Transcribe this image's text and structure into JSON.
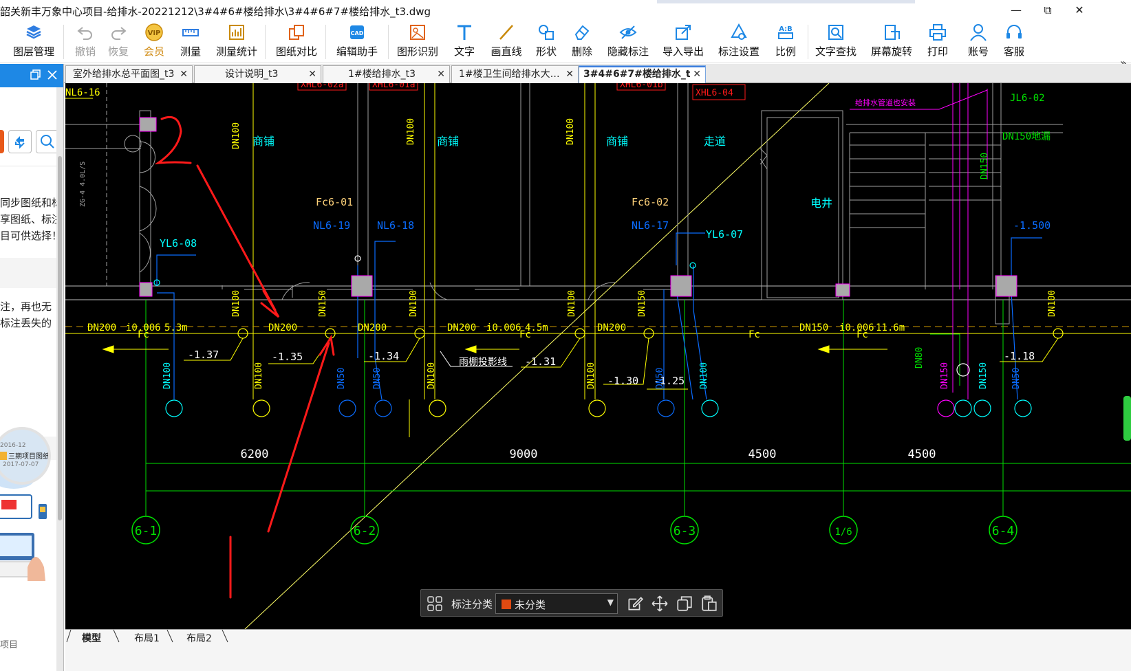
{
  "window": {
    "title": "韶关新丰万象中心项目-给排水-20221212\\3#4#6#楼给排水\\3#4#6#7#楼给排水_t3.dwg",
    "minimize": "—",
    "maximize": "⧉",
    "close": "✕"
  },
  "toolbar": [
    {
      "label": "图层管理",
      "icon": "layers-icon",
      "state": "normal"
    },
    {
      "label": "撤销",
      "icon": "undo-icon",
      "state": "disabled"
    },
    {
      "label": "恢复",
      "icon": "redo-icon",
      "state": "disabled"
    },
    {
      "label": "会员",
      "icon": "vip-icon",
      "state": "vip"
    },
    {
      "label": "测量",
      "icon": "measure-icon",
      "state": "normal"
    },
    {
      "label": "测量统计",
      "icon": "measure-stats-icon",
      "state": "normal"
    },
    {
      "label": "图纸对比",
      "icon": "compare-icon",
      "state": "normal"
    },
    {
      "label": "编辑助手",
      "icon": "edit-assistant-icon",
      "state": "normal"
    },
    {
      "label": "图形识别",
      "icon": "shape-recognize-icon",
      "state": "normal"
    },
    {
      "label": "文字",
      "icon": "text-icon",
      "state": "normal"
    },
    {
      "label": "画直线",
      "icon": "line-icon",
      "state": "normal"
    },
    {
      "label": "形状",
      "icon": "shapes-icon",
      "state": "normal"
    },
    {
      "label": "删除",
      "icon": "eraser-icon",
      "state": "normal"
    },
    {
      "label": "隐藏标注",
      "icon": "hide-eye-icon",
      "state": "normal"
    },
    {
      "label": "导入导出",
      "icon": "import-export-icon",
      "state": "normal"
    },
    {
      "label": "标注设置",
      "icon": "markup-settings-icon",
      "state": "normal"
    },
    {
      "label": "比例",
      "icon": "scale-icon",
      "state": "normal"
    },
    {
      "label": "文字查找",
      "icon": "text-search-icon",
      "state": "normal"
    },
    {
      "label": "屏幕旋转",
      "icon": "rotate-screen-icon",
      "state": "normal"
    },
    {
      "label": "打印",
      "icon": "printer-icon",
      "state": "normal"
    },
    {
      "label": "账号",
      "icon": "user-icon",
      "state": "normal"
    },
    {
      "label": "客服",
      "icon": "headset-icon",
      "state": "normal"
    }
  ],
  "sidebar": {
    "lines": [
      "同步图纸和标",
      "享图纸、标注",
      "目可供选择！",
      "注，再也无",
      "标注丢失的"
    ],
    "card_date1": "2016-12",
    "card_label": "三期项目图纸",
    "card_date2": "2017-07-07",
    "bottom": "项目"
  },
  "tabs": [
    {
      "label": "室外给排水总平面图_t3",
      "active": false
    },
    {
      "label": "设计说明_t3",
      "active": false
    },
    {
      "label": "1#楼给排水_t3",
      "active": false
    },
    {
      "label": "1#楼卫生间给排水大…",
      "active": false
    },
    {
      "label": "3#4#6#7#楼给排水_t3",
      "active": true
    }
  ],
  "tab_close": "✕",
  "drawing": {
    "spaces": [
      "商铺",
      "商铺",
      "商铺",
      "走道",
      "电井"
    ],
    "tags": [
      "XHL6-02a",
      "XHL6-01a",
      "XHL6-01b",
      "XHL6-04",
      "JL6-02",
      "DN150地漏",
      "给排水管道也安装",
      "Fc6-01",
      "NL6-19",
      "NL6-18",
      "Fc6-02",
      "NL6-17",
      "YL6-07",
      "NL6-16",
      "YL6-08",
      "-1.500"
    ],
    "pipe_labels": [
      "DN200",
      "i0.006",
      "5.3m",
      "DN200",
      "DN200",
      "DN200",
      "i0.006",
      "4.5m",
      "DN200",
      "DN150",
      "i0.006",
      "11.6m",
      "Fc",
      "Fc",
      "Fc",
      "Fc"
    ],
    "levels": [
      "-1.37",
      "-1.35",
      "-1.34",
      "-1.31",
      "-1.30",
      "-1.25",
      "-1.18"
    ],
    "canopy_note": "雨棚投影线",
    "dims": [
      "6200",
      "9000",
      "4500",
      "4500"
    ],
    "axes": [
      "6-1",
      "6-2",
      "6-3",
      "1/6",
      "6-4"
    ],
    "annotation_2": "2",
    "annotation_1": "1"
  },
  "markup_panel": {
    "label": "标注分类",
    "value": "未分类",
    "swatch": "#e04a12"
  },
  "layouts": [
    "模型",
    "布局1",
    "布局2"
  ],
  "colors": {
    "yellow": "#ffff00",
    "green": "#00ff00",
    "cyan": "#00ffff",
    "blue": "#0a6cff",
    "red": "#ff1a1a",
    "magenta": "#ff00ff",
    "gray": "#a0a0a0",
    "white": "#ffffff",
    "accent": "#1e88e5"
  }
}
